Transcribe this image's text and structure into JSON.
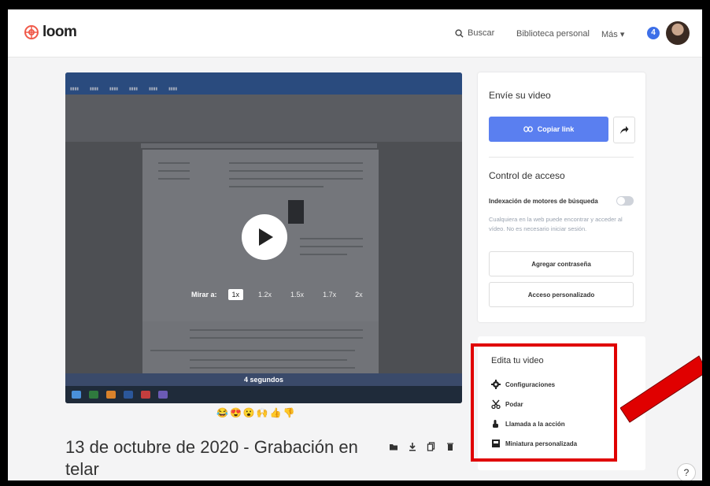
{
  "header": {
    "logo_text": "loom",
    "search_label": "Buscar",
    "library_label": "Biblioteca personal",
    "more_label": "Más ▾",
    "notification_count": "4"
  },
  "video": {
    "speed_label": "Mirar a:",
    "speeds": [
      "1x",
      "1.2x",
      "1.5x",
      "1.7x",
      "2x"
    ],
    "selected_speed": "1x",
    "duration": "4 segundos",
    "reactions": [
      "😂",
      "😍",
      "😮",
      "🙌",
      "👍",
      "👎"
    ],
    "title": "13 de octubre de 2020 - Grabación en telar"
  },
  "share": {
    "title": "Envíe su video",
    "copy_link_label": "Copiar link",
    "access_title": "Control de acceso",
    "indexing_label": "Indexación de motores de búsqueda",
    "indexing_description": "Cualquiera en la web puede encontrar y acceder al vídeo. No es necesario iniciar sesión.",
    "add_password_label": "Agregar contraseña",
    "custom_access_label": "Acceso personalizado"
  },
  "edit": {
    "title": "Edita tu video",
    "items": [
      {
        "label": "Configuraciones",
        "icon": "gear-icon"
      },
      {
        "label": "Podar",
        "icon": "scissors-icon"
      },
      {
        "label": "Llamada a la acción",
        "icon": "cta-icon"
      },
      {
        "label": "Miniatura personalizada",
        "icon": "thumbnail-icon"
      }
    ]
  },
  "help_label": "?",
  "colors": {
    "accent": "#5a7ff0",
    "highlight": "#e00000",
    "brand": "#f05a4a"
  }
}
